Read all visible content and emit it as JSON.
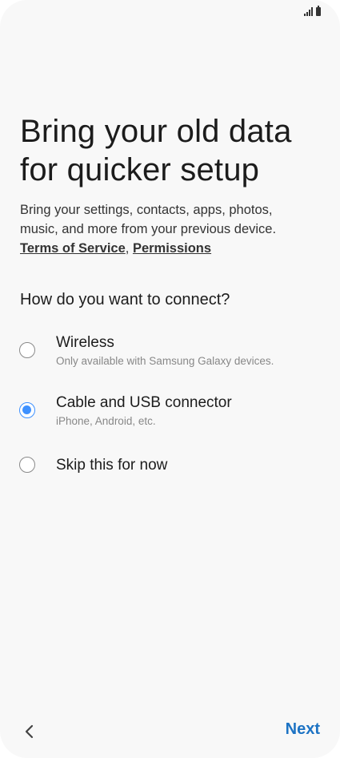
{
  "title": {
    "line1": "Bring your old data",
    "line2": "for quicker setup"
  },
  "description": {
    "line1": "Bring your settings, contacts, apps, photos,",
    "line2": "music, and more from your previous device.",
    "terms_link": "Terms of Service",
    "separator": ", ",
    "permissions_link": "Permissions"
  },
  "question": "How do you want to connect?",
  "options": [
    {
      "label": "Wireless",
      "subtitle": "Only available with Samsung Galaxy devices.",
      "selected": false
    },
    {
      "label": "Cable and USB connector",
      "subtitle": "iPhone, Android, etc.",
      "selected": true
    },
    {
      "label": "Skip this for now",
      "subtitle": "",
      "selected": false
    }
  ],
  "navigation": {
    "back_icon": "chevron-left-icon",
    "next_label": "Next"
  },
  "colors": {
    "accent": "#3e91ff",
    "next": "#1d73c4",
    "background": "#f8f8f8"
  },
  "status_bar": {
    "icons": [
      "signal-icon",
      "battery-icon"
    ]
  }
}
